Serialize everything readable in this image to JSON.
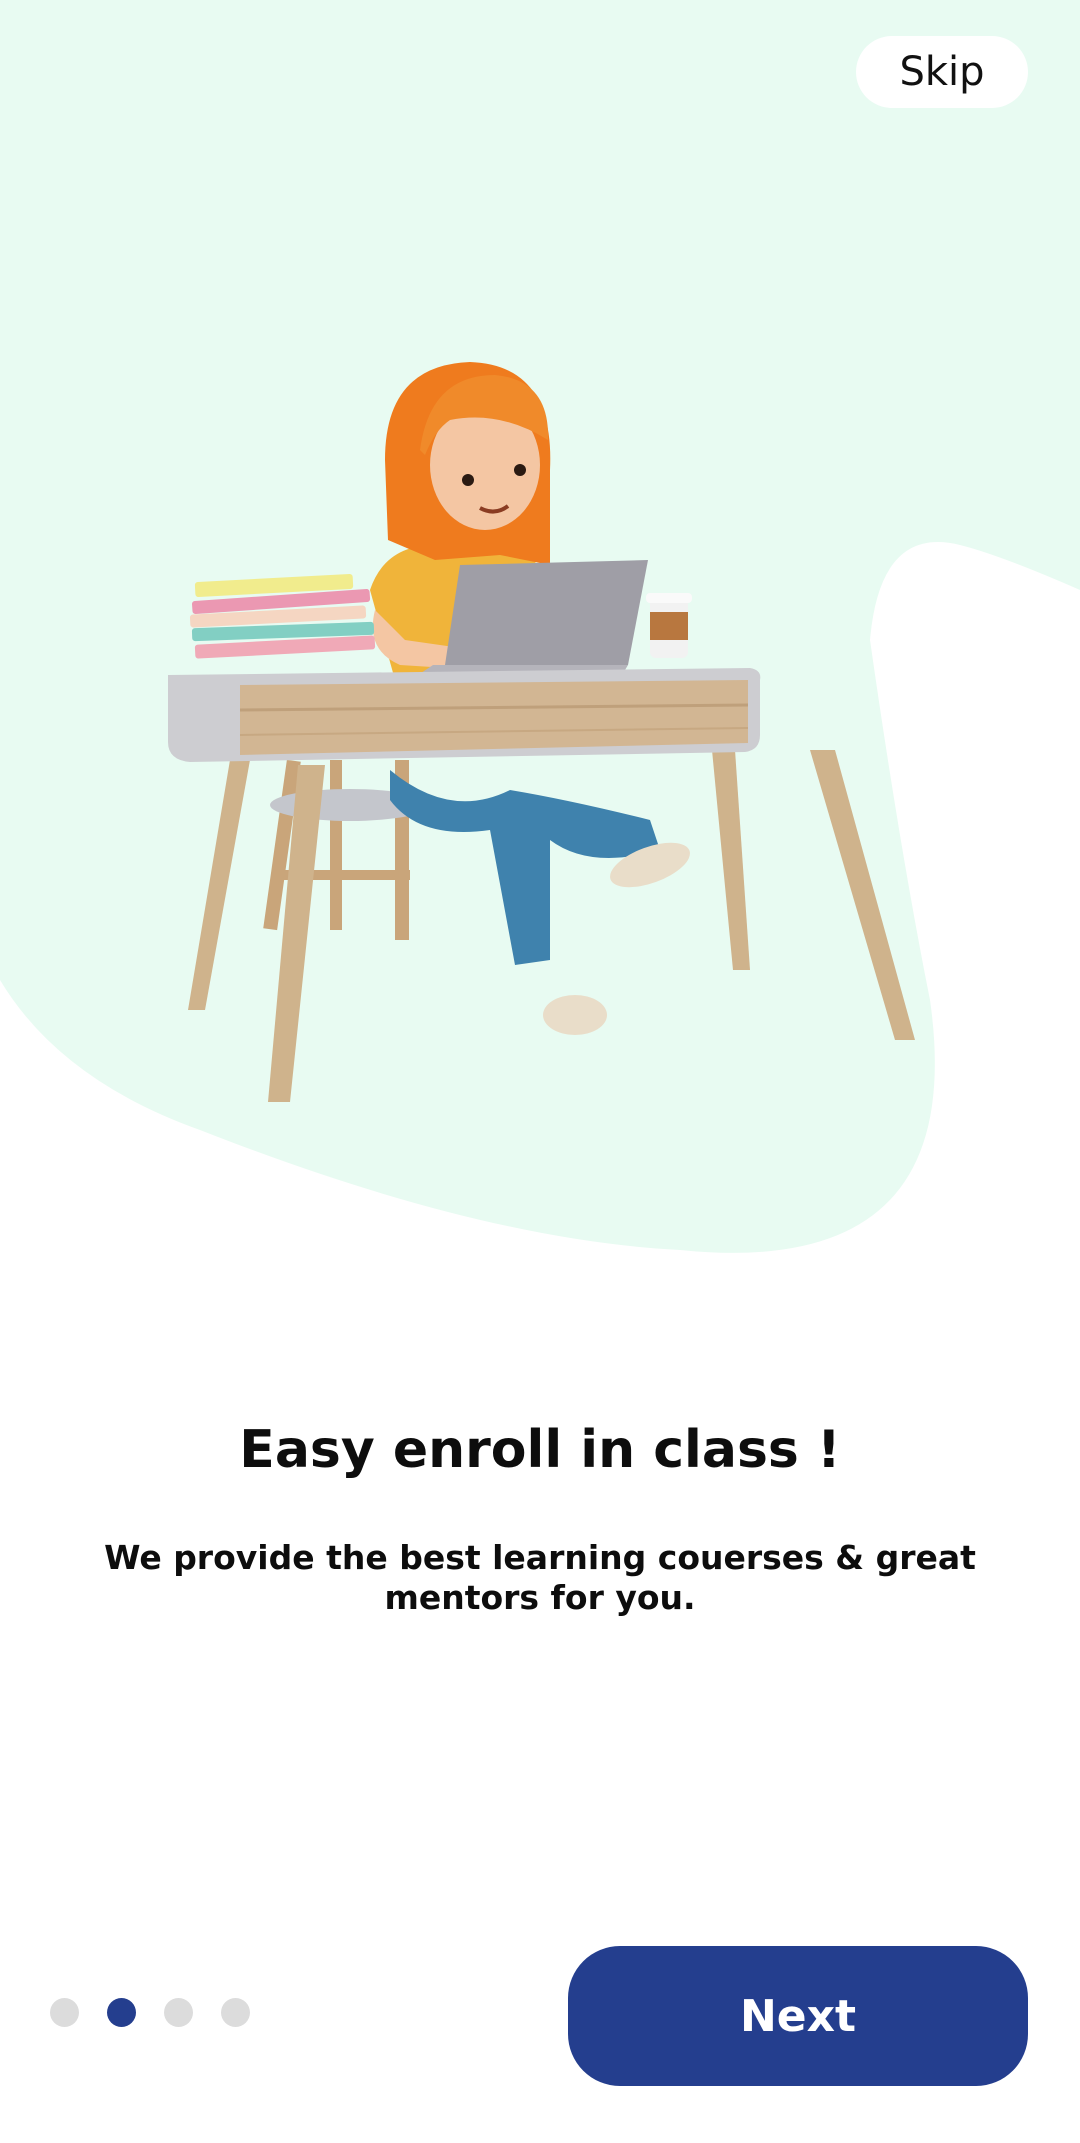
{
  "header": {
    "skip_label": "Skip"
  },
  "onboarding": {
    "title": "Easy enroll in class !",
    "subtitle": "We provide the best  learning couerses & great mentors for you."
  },
  "pager": {
    "total": 4,
    "active_index": 1
  },
  "footer": {
    "next_label": "Next"
  },
  "colors": {
    "background_blob": "#e8fbf2",
    "primary": "#243e8e",
    "dot_inactive": "#dcdcdc"
  }
}
